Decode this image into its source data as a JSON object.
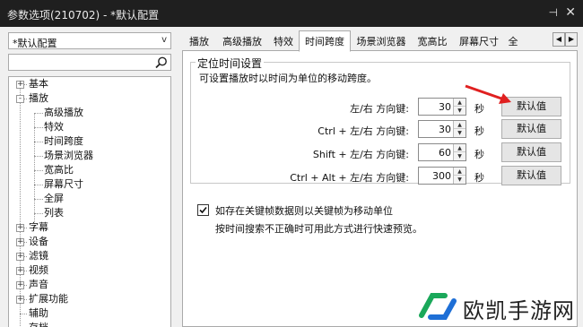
{
  "window": {
    "title": "参数选项(210702) - *默认配置",
    "pin_icon": "pin-icon",
    "close_icon": "close-icon"
  },
  "preset": {
    "value": "*默认配置",
    "arrow": "v"
  },
  "search": {
    "value": "",
    "placeholder": ""
  },
  "tree": {
    "items": [
      {
        "label": "基本",
        "level": 0,
        "expander": "+"
      },
      {
        "label": "播放",
        "level": 0,
        "expander": "-"
      },
      {
        "label": "高级播放",
        "level": 1
      },
      {
        "label": "特效",
        "level": 1
      },
      {
        "label": "时间跨度",
        "level": 1
      },
      {
        "label": "场景浏览器",
        "level": 1
      },
      {
        "label": "宽高比",
        "level": 1
      },
      {
        "label": "屏幕尺寸",
        "level": 1
      },
      {
        "label": "全屏",
        "level": 1
      },
      {
        "label": "列表",
        "level": 1
      },
      {
        "label": "字幕",
        "level": 0,
        "expander": "+"
      },
      {
        "label": "设备",
        "level": 0,
        "expander": "+"
      },
      {
        "label": "滤镜",
        "level": 0,
        "expander": "+"
      },
      {
        "label": "视频",
        "level": 0,
        "expander": "+"
      },
      {
        "label": "声音",
        "level": 0,
        "expander": "+"
      },
      {
        "label": "扩展功能",
        "level": 0,
        "expander": "+"
      },
      {
        "label": "辅助",
        "level": 0
      },
      {
        "label": "存档",
        "level": 0
      }
    ]
  },
  "tabs": [
    {
      "label": "播放",
      "active": false
    },
    {
      "label": "高级播放",
      "active": false
    },
    {
      "label": "特效",
      "active": false
    },
    {
      "label": "时间跨度",
      "active": true
    },
    {
      "label": "场景浏览器",
      "active": false
    },
    {
      "label": "宽高比",
      "active": false
    },
    {
      "label": "屏幕尺寸",
      "active": false
    },
    {
      "label": "全",
      "active": false
    }
  ],
  "tab_scroll": {
    "left": "◀",
    "right": "▶"
  },
  "group": {
    "title": "定位时间设置",
    "description": "可设置播放时以时间为单位的移动跨度。",
    "rows": [
      {
        "label": "左/右 方向键:",
        "value": "30",
        "unit": "秒",
        "button": "默认值"
      },
      {
        "label": "Ctrl + 左/右 方向键:",
        "value": "30",
        "unit": "秒",
        "button": "默认值"
      },
      {
        "label": "Shift + 左/右 方向键:",
        "value": "60",
        "unit": "秒",
        "button": "默认值"
      },
      {
        "label": "Ctrl + Alt + 左/右 方向键:",
        "value": "300",
        "unit": "秒",
        "button": "默认值"
      }
    ]
  },
  "keyframe": {
    "checked": true,
    "label": "如存在关键帧数据则以关键帧为移动单位",
    "hint": "按时间搜索不正确时可用此方式进行快速预览。"
  },
  "watermark": {
    "text": "欧凯手游网"
  },
  "colors": {
    "titlebar": "#1f1f1f",
    "annotation_arrow": "#e02020",
    "watermark_green": "#1aa85a",
    "watermark_blue": "#1e6fd6"
  }
}
